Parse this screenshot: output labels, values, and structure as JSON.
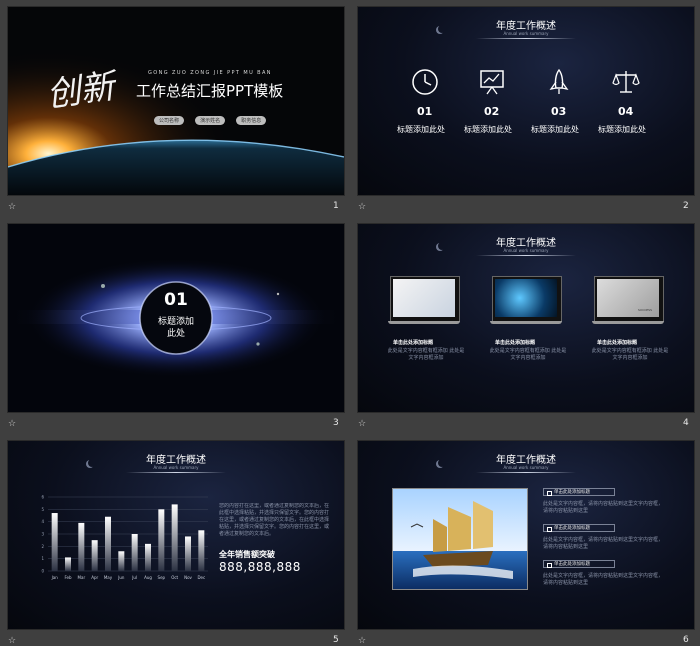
{
  "thumbnails": [
    {
      "number": "1"
    },
    {
      "number": "2"
    },
    {
      "number": "3"
    },
    {
      "number": "4"
    },
    {
      "number": "5"
    },
    {
      "number": "6"
    }
  ],
  "slide1": {
    "calligraphy": "创新",
    "pinyin": "GONG ZUO ZONG JIE PPT MU BAN",
    "title": "工作总结汇报PPT模板",
    "pills": [
      "公司名称",
      "演示姓名",
      "职务信息"
    ]
  },
  "slide2": {
    "title": "年度工作概述",
    "subtitle": "Annual work summary",
    "items": [
      {
        "icon": "clock-icon",
        "num": "01",
        "label": "标题添加此处"
      },
      {
        "icon": "presentation-board-icon",
        "num": "02",
        "label": "标题添加此处"
      },
      {
        "icon": "rocket-icon",
        "num": "03",
        "label": "标题添加此处"
      },
      {
        "icon": "scales-icon",
        "num": "04",
        "label": "标题添加此处"
      }
    ]
  },
  "slide3": {
    "num": "01",
    "label_line1": "标题添加",
    "label_line2": "此处"
  },
  "slide4": {
    "title": "年度工作概述",
    "subtitle": "Annual work summary",
    "cards": [
      {
        "caption": "单击此处添加标题",
        "desc": "此处是文字内容框有框添加 此处是文字内容框添加"
      },
      {
        "caption": "单击此处添加标题",
        "desc": "此处是文字内容框有框添加 此处是文字内容框添加"
      },
      {
        "caption": "单击此处添加标题",
        "desc": "此处是文字内容框有框添加 此处是文字内容框添加"
      }
    ],
    "screen_text": "SUCCESS"
  },
  "slide5": {
    "title": "年度工作概述",
    "subtitle": "Annual work summary",
    "paragraph": "您的内容打在这里，或者通过复制您的文本后，在此框中选择粘贴，并选择只保留文字。您的内容打在这里，或者通过复制您的文本后，在此框中选择粘贴，并选择只保留文字。您的内容打在这里，或者通过复制您的文本后。",
    "headline": "全年销售额突破",
    "big_number": "888,888,888"
  },
  "chart_data": {
    "type": "bar",
    "categories": [
      "Jan",
      "Feb",
      "Mar",
      "Apr",
      "May",
      "Jun",
      "Jul",
      "Aug",
      "Sep",
      "Oct",
      "Nov",
      "Dec"
    ],
    "values": [
      4.7,
      1.1,
      3.9,
      2.5,
      4.4,
      1.6,
      3.0,
      2.2,
      5.0,
      5.4,
      2.8,
      3.3
    ],
    "ylim": [
      0,
      6
    ],
    "yticks": [
      "0",
      "1",
      "2",
      "3",
      "4",
      "5",
      "6"
    ],
    "grid": true,
    "colors": {
      "bar_top": "#ffffff",
      "bar_bottom": "#2b3142"
    }
  },
  "slide6": {
    "title": "年度工作概述",
    "subtitle": "Annual work summary",
    "items": [
      {
        "label": "单击此处添加标题",
        "desc": "此处是文字内容框，请将内容粘贴到这里文字内容框，请将内容粘贴到这里"
      },
      {
        "label": "单击此处添加标题",
        "desc": "此处是文字内容框，请将内容粘贴到这里文字内容框，请将内容粘贴到这里"
      },
      {
        "label": "单击此处添加标题",
        "desc": "此处是文字内容框，请将内容粘贴到这里文字内容框，请将内容粘贴到这里"
      }
    ]
  }
}
